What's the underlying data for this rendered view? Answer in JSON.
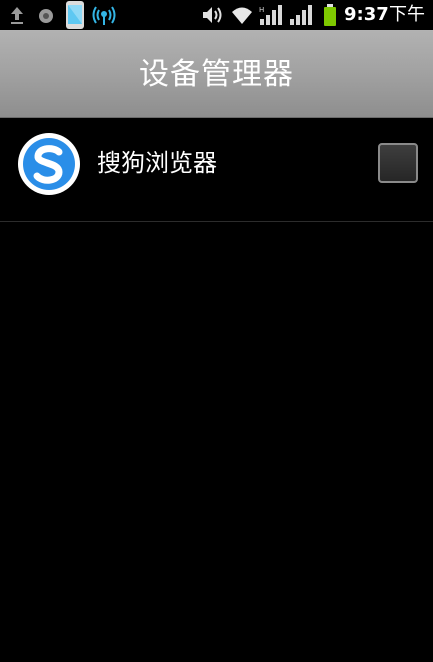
{
  "status_bar": {
    "time": "9:37",
    "ampm": "下午",
    "icons": [
      "upload-icon",
      "circle-notification-icon",
      "phone-icon",
      "hotspot-icon",
      "volume-icon",
      "wifi-icon",
      "signal-icon",
      "signal-icon",
      "battery-icon"
    ],
    "accent_colors": {
      "hotspot": "#33b5e5",
      "phone": "#5ec8f2",
      "battery": "#7ec800"
    }
  },
  "title_bar": {
    "title": "设备管理器"
  },
  "device_admins": [
    {
      "label": "搜狗浏览器",
      "icon": "sogou-browser-icon",
      "checked": false
    }
  ],
  "colors": {
    "background": "#000000",
    "title_bar": "#a3a3a3",
    "sogou_blue": "#2a8ee8"
  }
}
